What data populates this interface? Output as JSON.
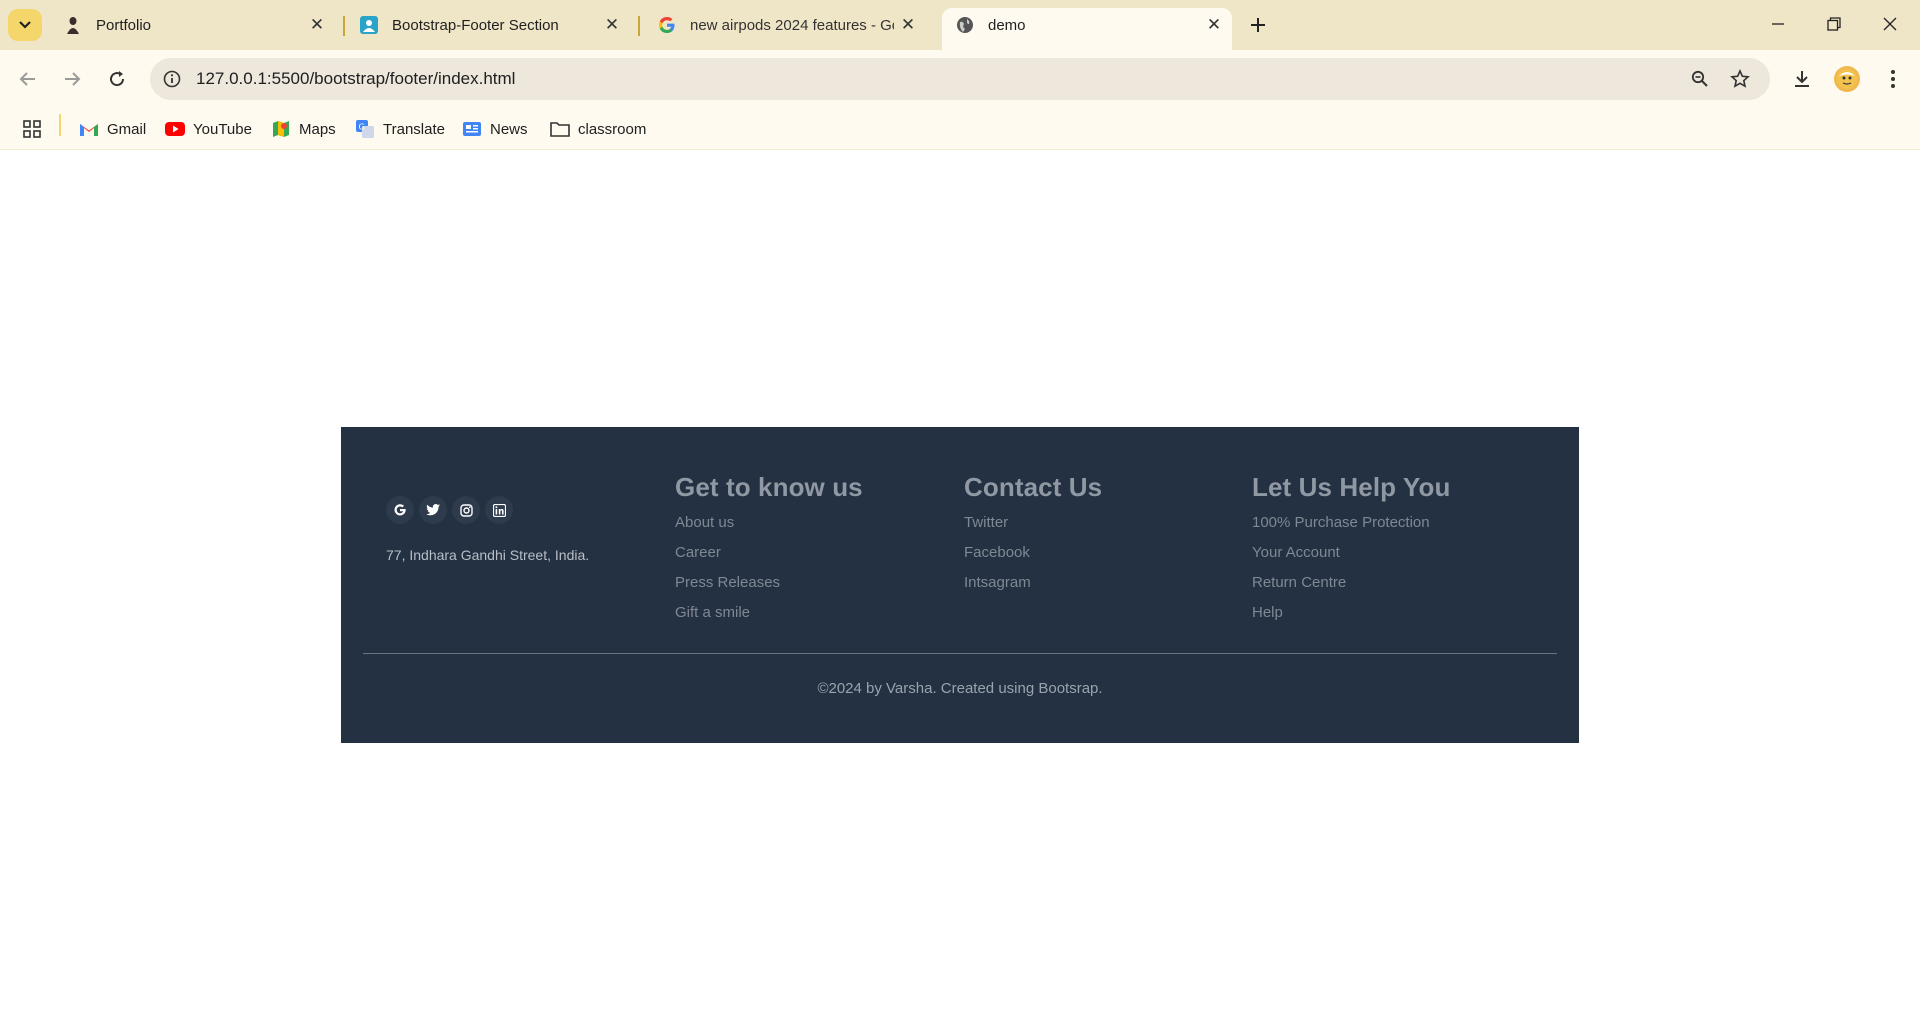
{
  "browser": {
    "tabs": [
      {
        "title": "Portfolio",
        "icon": "portfolio-favicon"
      },
      {
        "title": "Bootstrap-Footer Section",
        "icon": "bootstrap-favicon"
      },
      {
        "title": "new airpods 2024 features - Go",
        "icon": "google-favicon"
      },
      {
        "title": "demo",
        "icon": "globe-icon",
        "active": true
      }
    ],
    "url": "127.0.0.1:5500/bootstrap/footer/index.html",
    "bookmarks": [
      {
        "label": "Gmail"
      },
      {
        "label": "YouTube"
      },
      {
        "label": "Maps"
      },
      {
        "label": "Translate"
      },
      {
        "label": "News"
      },
      {
        "label": "classroom"
      }
    ]
  },
  "footer": {
    "address": "77, Indhara Gandhi Street, India.",
    "social_icons": [
      "google-icon",
      "twitter-icon",
      "instagram-icon",
      "linkedin-icon"
    ],
    "columns": [
      {
        "heading": "Get to know us",
        "links": [
          "About us",
          "Career",
          "Press Releases",
          "Gift a smile"
        ]
      },
      {
        "heading": "Contact Us",
        "links": [
          "Twitter",
          "Facebook",
          "Intsagram"
        ]
      },
      {
        "heading": "Let Us Help You",
        "links": [
          "100% Purchase Protection",
          "Your Account",
          "Return Centre",
          "Help"
        ]
      }
    ],
    "copyright": "©2024 by Varsha. Created using Bootsrap."
  },
  "colors": {
    "footer_bg": "#243142",
    "tabbar_bg": "#efe6c8",
    "toolbar_bg": "#fffaf0"
  }
}
